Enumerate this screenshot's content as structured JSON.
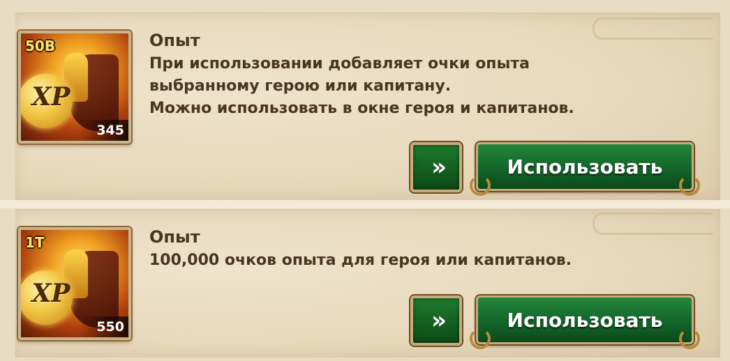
{
  "items": [
    {
      "icon": "xp-potion-icon",
      "tier": "50B",
      "count": "345",
      "xp_label": "XP",
      "title": "Опыт",
      "description_lines": [
        "При использовании добавляет очки опыта",
        "выбранному герою или капитану.",
        "Можно использовать в окне героя и капитанов."
      ],
      "arrow_label": "»",
      "use_label": "Использовать"
    },
    {
      "icon": "xp-potion-icon",
      "tier": "1T",
      "count": "550",
      "xp_label": "XP",
      "title": "Опыт",
      "description_lines": [
        "100,000 очков опыта для героя или капитанов."
      ],
      "arrow_label": "»",
      "use_label": "Использовать"
    }
  ],
  "colors": {
    "text": "#4a3522",
    "button_green": "#13642a",
    "parchment": "#e8d9bd",
    "frame_gold": "#c7ab7a"
  }
}
